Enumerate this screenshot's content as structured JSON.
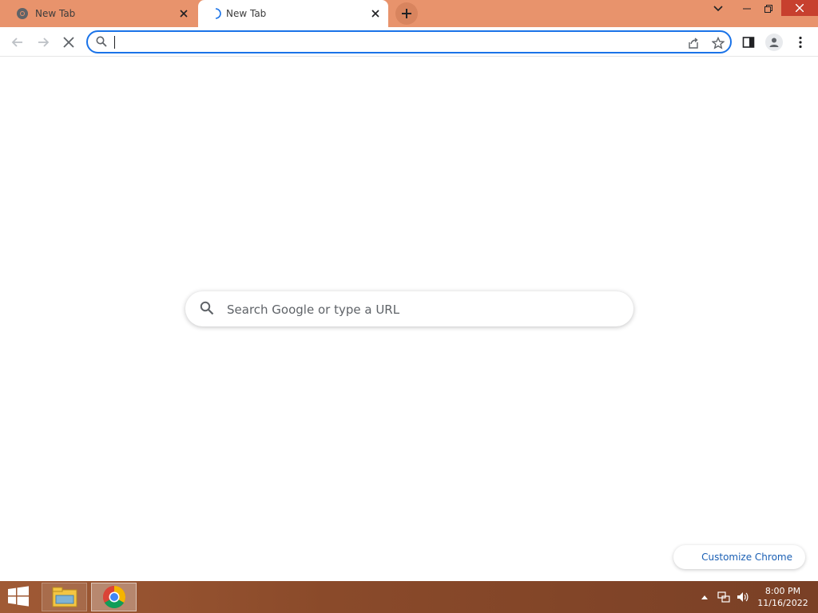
{
  "tabs": [
    {
      "title": "New Tab",
      "state": "inactive",
      "favicon": "chrome-icon"
    },
    {
      "title": "New Tab",
      "state": "active-loading",
      "favicon": "loading-spinner-icon"
    }
  ],
  "omnibox": {
    "value": "",
    "placeholder": ""
  },
  "ntp": {
    "search_placeholder": "Search Google or type a URL"
  },
  "customize": {
    "label": "Customize Chrome"
  },
  "clock": {
    "time": "8:00 PM",
    "date": "11/16/2022"
  },
  "colors": {
    "tabstrip": "#e8936c",
    "accent": "#1a73e8",
    "taskbar": "#8a4a2a",
    "close_button": "#c7402e"
  },
  "icons": [
    "back-arrow-icon",
    "forward-arrow-icon",
    "stop-loading-icon",
    "search-icon",
    "share-icon",
    "bookmark-star-icon",
    "side-panel-icon",
    "profile-icon",
    "menu-kebab-icon",
    "windows-start-icon",
    "file-explorer-icon",
    "chrome-icon"
  ]
}
